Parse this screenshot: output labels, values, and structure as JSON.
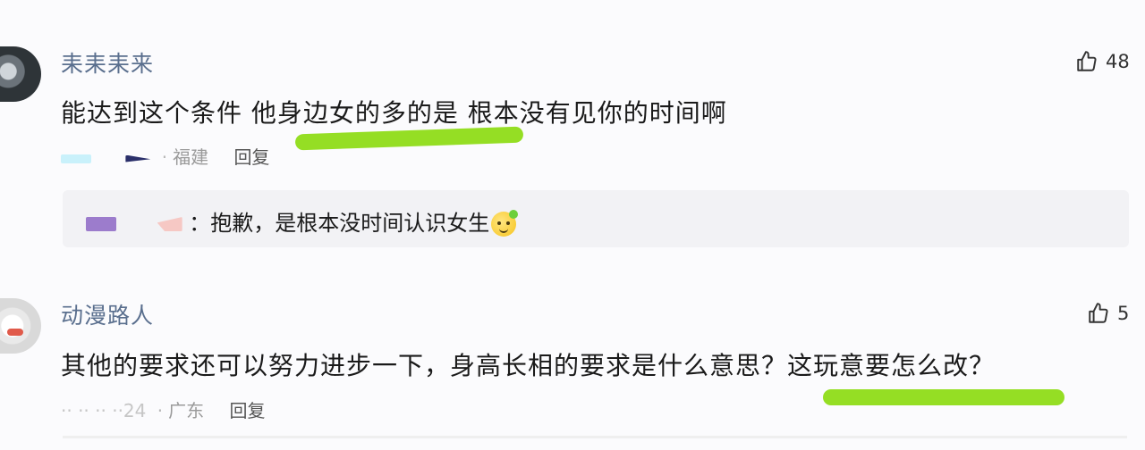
{
  "comments": [
    {
      "username": "耒耒耒来",
      "content": "能达到这个条件 他身边女的多的是 根本没有见你的时间啊",
      "location": "福建",
      "reply_label": "回复",
      "likes": "48",
      "replies": [
        {
          "text": "：抱歉，是根本没时间认识女生"
        }
      ]
    },
    {
      "username": "动漫路人",
      "content": "其他的要求还可以努力进步一下，身高长相的要求是什么意思？这玩意要怎么改？",
      "date_fragment": "·· ·· ·· ··24",
      "location": "广东",
      "reply_label": "回复",
      "likes": "5"
    }
  ],
  "icons": {
    "like": "thumbs-up-icon",
    "emoji": "smiley-emoji-icon"
  },
  "colors": {
    "highlight": "#8fdc18",
    "username": "#5a6f8e"
  }
}
